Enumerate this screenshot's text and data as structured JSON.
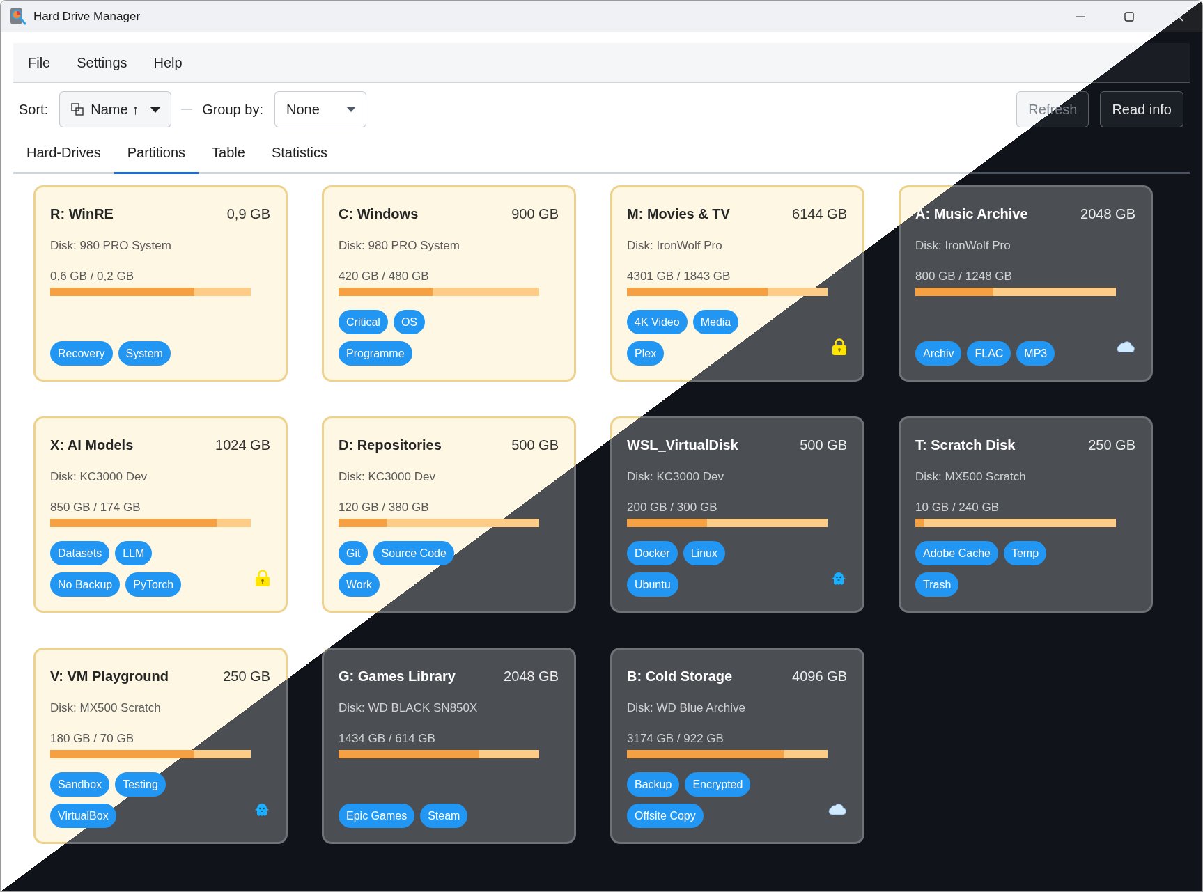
{
  "window": {
    "title": "Hard Drive Manager"
  },
  "menu": [
    "File",
    "Settings",
    "Help"
  ],
  "toolbar": {
    "sort_label": "Sort:",
    "sort_value": "Name ↑",
    "group_label": "Group by:",
    "group_value": "None",
    "buttons": [
      {
        "label": "Refresh",
        "kind": "light"
      },
      {
        "label": "Read info",
        "kind": "dark"
      }
    ]
  },
  "tabs": [
    {
      "label": "Hard-Drives",
      "selected": false
    },
    {
      "label": "Partitions",
      "selected": true
    },
    {
      "label": "Table",
      "selected": false
    },
    {
      "label": "Statistics",
      "selected": false
    }
  ],
  "partitions": [
    {
      "name": "R: WinRE",
      "size": "0,9 GB",
      "disk": "Disk: 980 PRO System",
      "usage": "0,6 GB / 0,2 GB",
      "level": 0.72,
      "kind": "light",
      "tag_rows": [
        [
          "Recovery",
          "System"
        ]
      ]
    },
    {
      "name": "C: Windows",
      "size": "900 GB",
      "disk": "Disk: 980 PRO System",
      "usage": "420 GB / 480 GB",
      "level": 0.47,
      "kind": "light",
      "tag_rows": [
        [
          "Critical",
          "OS"
        ],
        [
          "Programme"
        ]
      ]
    },
    {
      "name": "M: Movies & TV",
      "size": "6144 GB",
      "disk": "Disk: IronWolf Pro",
      "usage": "4301 GB / 1843 GB",
      "level": 0.7,
      "kind": "light",
      "tag_rows": [
        [
          "4K Video",
          "Media"
        ],
        [
          "Plex"
        ]
      ],
      "status": {
        "kind": "lock"
      }
    },
    {
      "name": "A: Music Archive",
      "size": "2048 GB",
      "disk": "Disk: IronWolf Pro",
      "usage": "800 GB / 1248 GB",
      "level": 0.39,
      "kind": "dark",
      "tag_rows": [
        [
          "Archiv",
          "FLAC",
          "MP3"
        ]
      ],
      "status": {
        "kind": "cloud"
      }
    },
    {
      "name": "X: AI Models",
      "size": "1024 GB",
      "disk": "Disk: KC3000 Dev",
      "usage": "850 GB / 174 GB",
      "level": 0.83,
      "kind": "light",
      "tag_rows": [
        [
          "Datasets",
          "LLM"
        ],
        [
          "No Backup",
          "PyTorch"
        ]
      ],
      "status": {
        "kind": "lock"
      }
    },
    {
      "name": "D: Repositories",
      "size": "500 GB",
      "disk": "Disk: KC3000 Dev",
      "usage": "120 GB / 380 GB",
      "level": 0.24,
      "kind": "light",
      "tag_rows": [
        [
          "Git",
          "Source Code"
        ],
        [
          "Work"
        ]
      ]
    },
    {
      "name": "WSL_VirtualDisk",
      "size": "500 GB",
      "disk": "Disk: KC3000 Dev",
      "usage": "200 GB / 300 GB",
      "level": 0.4,
      "kind": "dark",
      "tag_rows": [
        [
          "Docker",
          "Linux"
        ],
        [
          "Ubuntu"
        ]
      ],
      "status": {
        "kind": "ghost"
      }
    },
    {
      "name": "T: Scratch Disk",
      "size": "250 GB",
      "disk": "Disk: MX500 Scratch",
      "usage": "10 GB / 240 GB",
      "level": 0.04,
      "kind": "dark",
      "tag_rows": [
        [
          "Adobe Cache",
          "Temp"
        ],
        [
          "Trash"
        ]
      ]
    },
    {
      "name": "V: VM Playground",
      "size": "250 GB",
      "disk": "Disk: MX500 Scratch",
      "usage": "180 GB / 70 GB",
      "level": 0.72,
      "kind": "light",
      "tag_rows": [
        [
          "Sandbox",
          "Testing"
        ],
        [
          "VirtualBox"
        ]
      ],
      "status": {
        "kind": "ghost"
      }
    },
    {
      "name": "G: Games Library",
      "size": "2048 GB",
      "disk": "Disk: WD BLACK SN850X",
      "usage": "1434 GB / 614 GB",
      "level": 0.7,
      "kind": "dark",
      "tag_rows": [
        [
          "Epic Games",
          "Steam"
        ]
      ]
    },
    {
      "name": "B: Cold Storage",
      "size": "4096 GB",
      "disk": "Disk: WD Blue Archive",
      "usage": "3174 GB / 922 GB",
      "level": 0.78,
      "kind": "dark",
      "tag_rows": [
        [
          "Backup",
          "Encrypted"
        ],
        [
          "Offsite Copy"
        ]
      ],
      "status": {
        "kind": "cloud"
      }
    }
  ]
}
